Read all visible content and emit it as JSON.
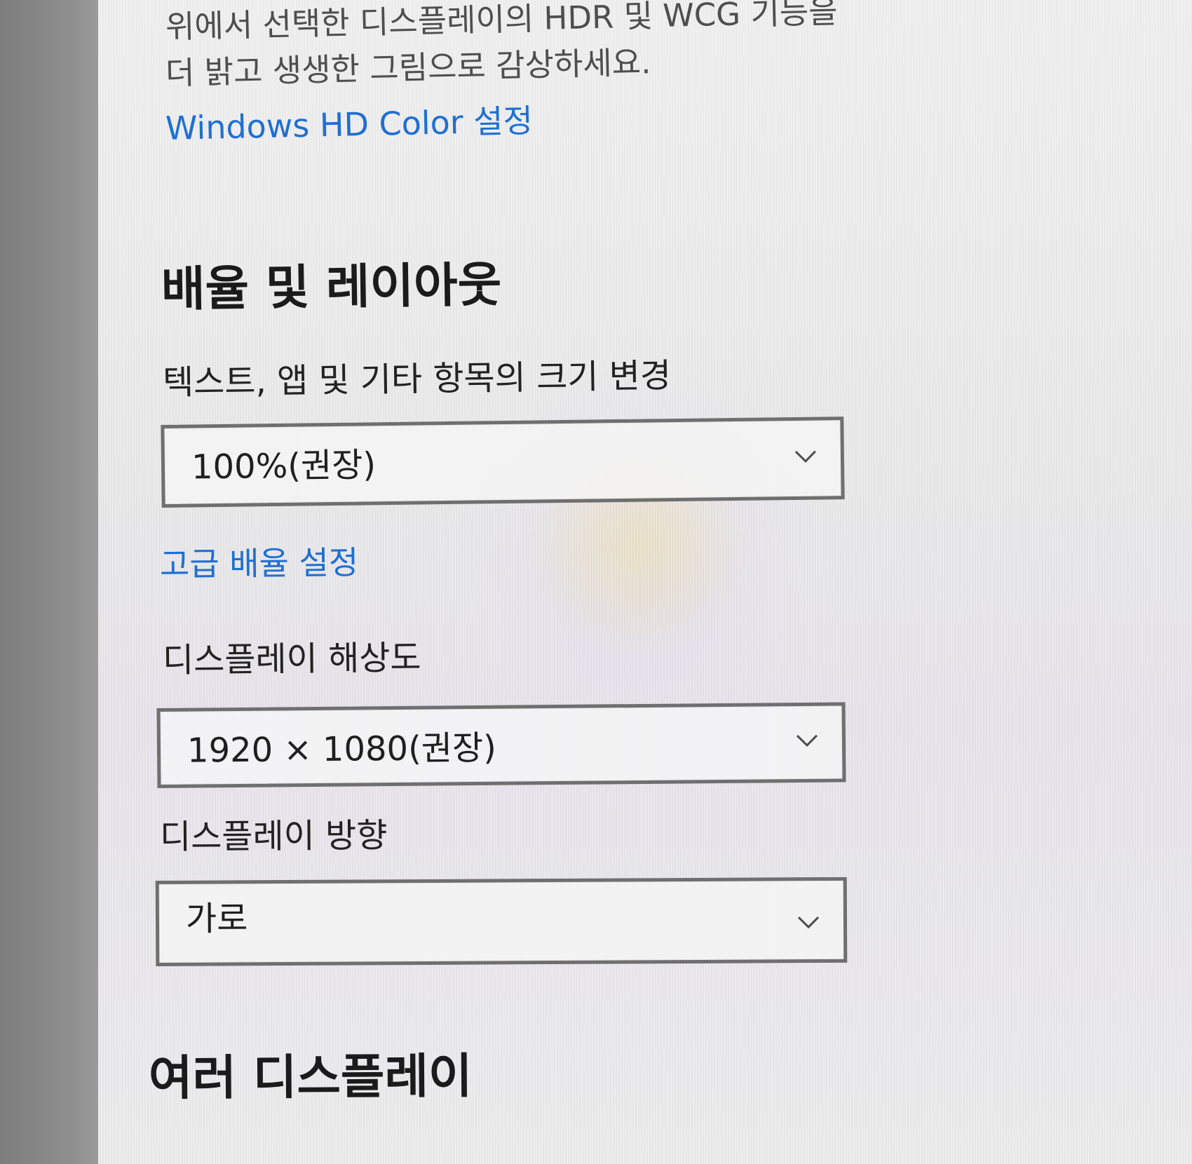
{
  "display_settings": {
    "hdr_description": {
      "line1": "위에서 선택한 디스플레이의 HDR 및 WCG 기능을",
      "line2": "더 밝고 생생한 그림으로 감상하세요."
    },
    "windows_hd_color_link": "Windows HD Color 설정",
    "scale_layout": {
      "title": "배율 및 레이아웃",
      "text_size_label": "텍스트, 앱 및 기타 항목의 크기 변경",
      "text_size_value": "100%(권장)",
      "advanced_scaling_link": "고급 배율 설정",
      "resolution_label": "디스플레이 해상도",
      "resolution_value": "1920 × 1080(권장)",
      "orientation_label": "디스플레이 방향",
      "orientation_value": "가로"
    },
    "multiple_displays": {
      "title": "여러 디스플레이"
    }
  },
  "icons": {
    "chevron": "chevron-down-icon"
  }
}
